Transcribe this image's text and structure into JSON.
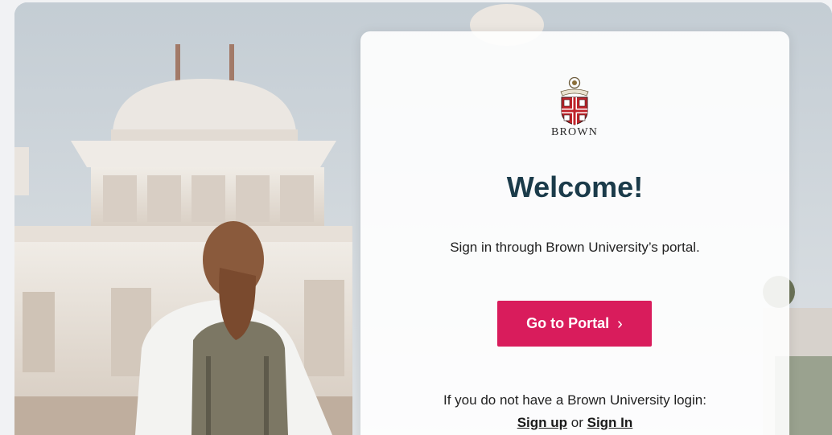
{
  "brand": {
    "logo_icon": "brown-university-shield-icon",
    "logo_text": "BROWN",
    "shield_color": "#c0242b"
  },
  "welcome": {
    "title": "Welcome!",
    "subtitle": "Sign in through Brown University’s portal."
  },
  "portal_button": {
    "label": "Go to Portal",
    "icon": "chevron-right-icon",
    "color": "#d91c5c"
  },
  "alt_login": {
    "prompt": "If you do not have a Brown University login:",
    "sign_up": "Sign up",
    "separator": "or",
    "sign_in": "Sign In"
  }
}
